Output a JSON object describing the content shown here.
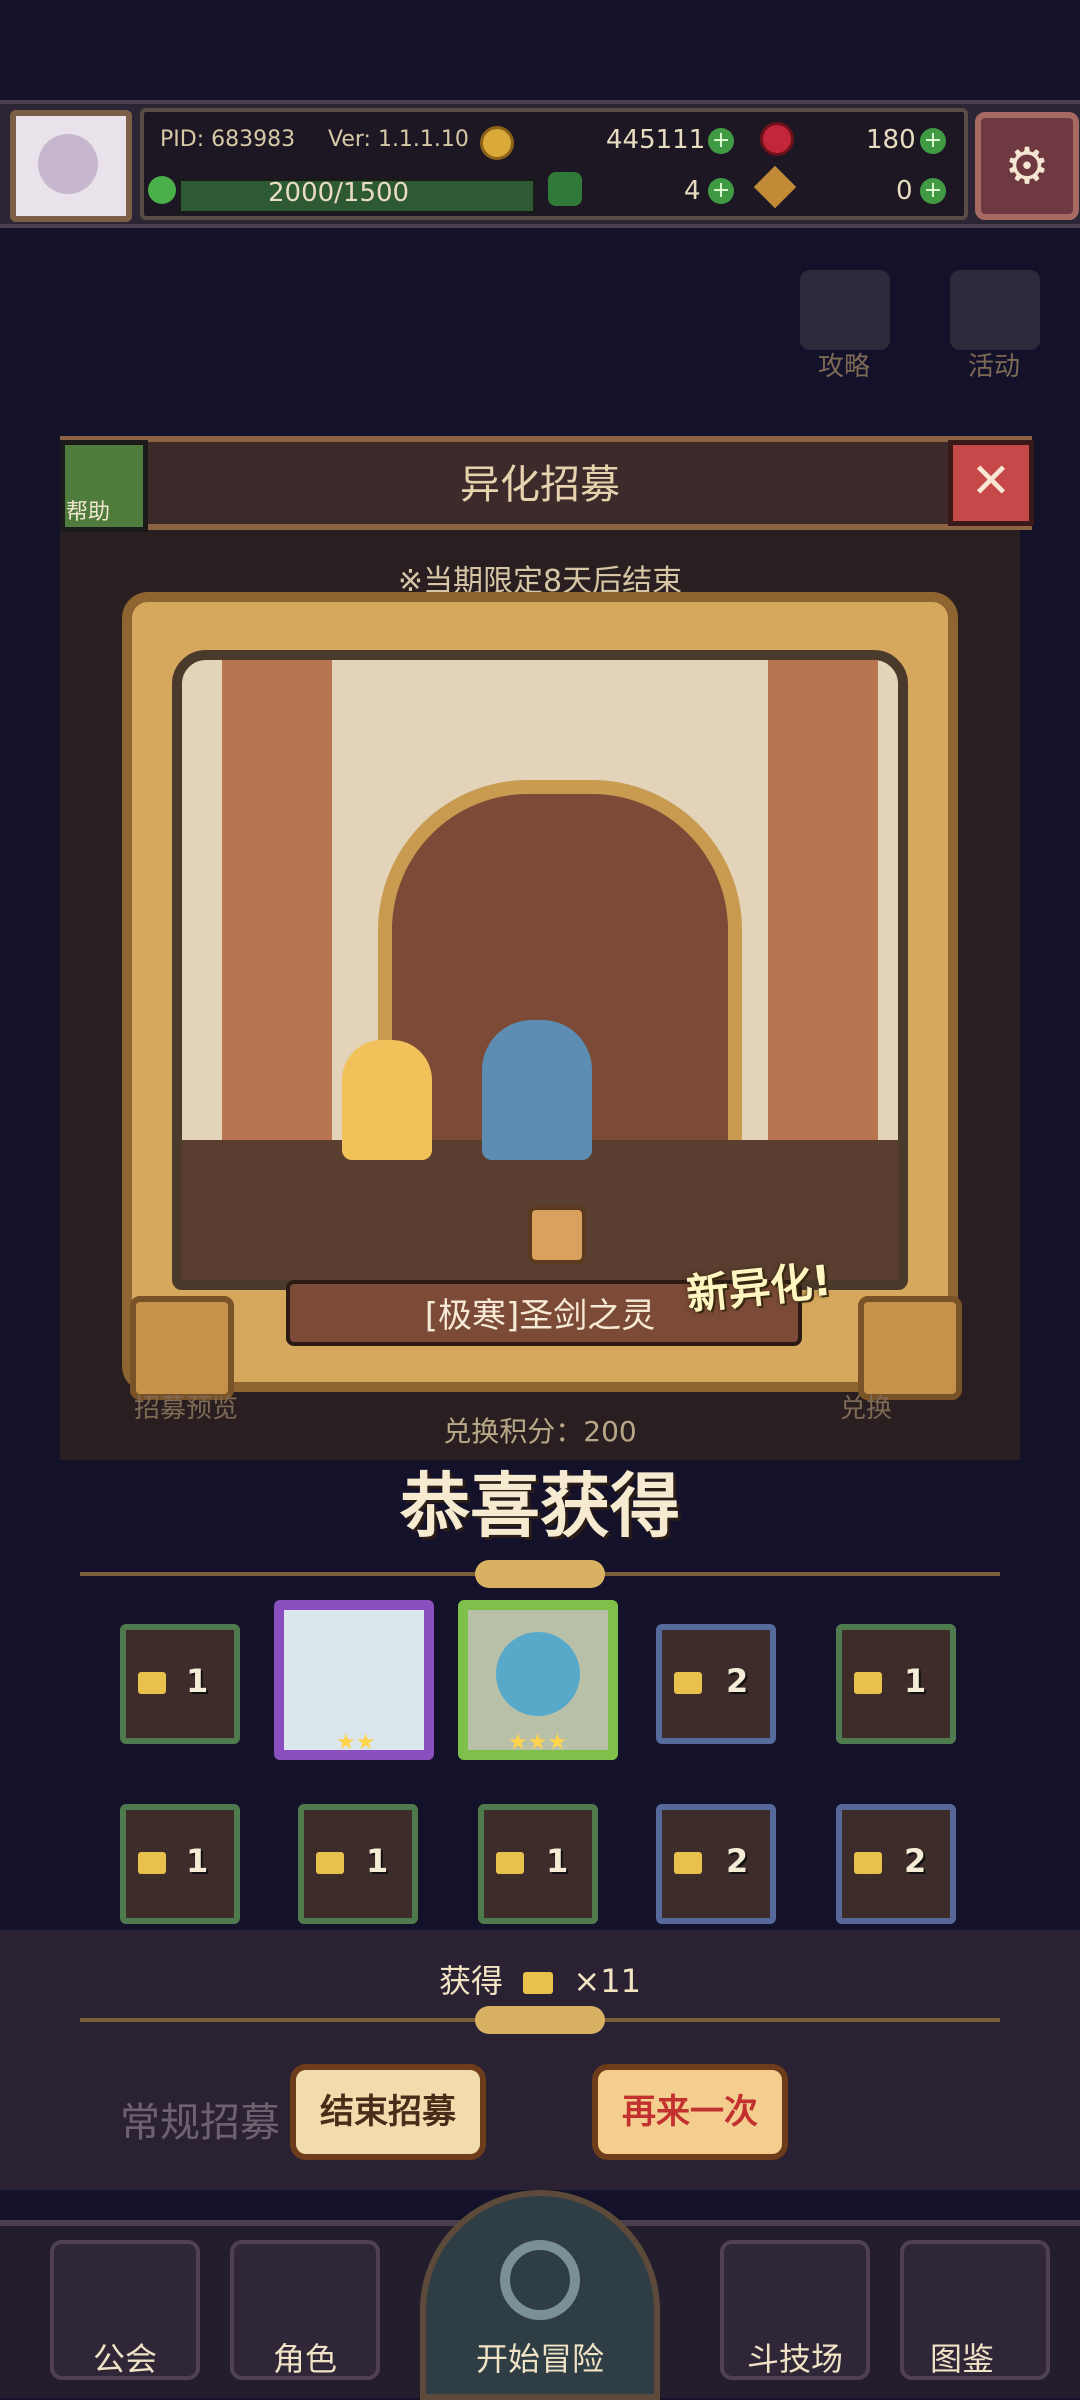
{
  "top": {
    "pid": "PID: 683983",
    "version": "Ver: 1.1.1.10",
    "gold": "445111",
    "gems": "180",
    "stamina": "2000/1500",
    "clover": "4",
    "key": "0"
  },
  "background": {
    "guide_label": "攻略",
    "event_label": "活动"
  },
  "dialog": {
    "title": "异化招募",
    "help_label": "帮助",
    "limited_notice": "※当期限定8天后结束",
    "exchange_points": "兑换积分：200",
    "preview_label": "招募预览",
    "exchange_label": "兑换"
  },
  "card": {
    "character_name": "[极寒]圣剑之灵",
    "new_tag": "新异化!"
  },
  "result": {
    "congrats": "恭喜获得",
    "obtain_label": "获得",
    "obtain_count": "×11"
  },
  "slots": [
    {
      "count": "1",
      "border": "green"
    },
    {
      "count": "",
      "stars": "★★",
      "border": "purple"
    },
    {
      "count": "",
      "stars": "★★★",
      "border": "gold"
    },
    {
      "count": "2",
      "border": "blue"
    },
    {
      "count": "1",
      "border": "green"
    },
    {
      "count": "1",
      "border": "green"
    },
    {
      "count": "1",
      "border": "green"
    },
    {
      "count": "1",
      "border": "green"
    },
    {
      "count": "2",
      "border": "blue"
    },
    {
      "count": "2",
      "border": "blue"
    }
  ],
  "buttons": {
    "end": "结束招募",
    "again": "再来一次"
  },
  "lower": {
    "normal_recruit": "常规招募"
  },
  "nav": [
    {
      "label": "公会"
    },
    {
      "label": "角色"
    },
    {
      "label": "开始冒险"
    },
    {
      "label": "斗技场"
    },
    {
      "label": "图鉴"
    }
  ]
}
